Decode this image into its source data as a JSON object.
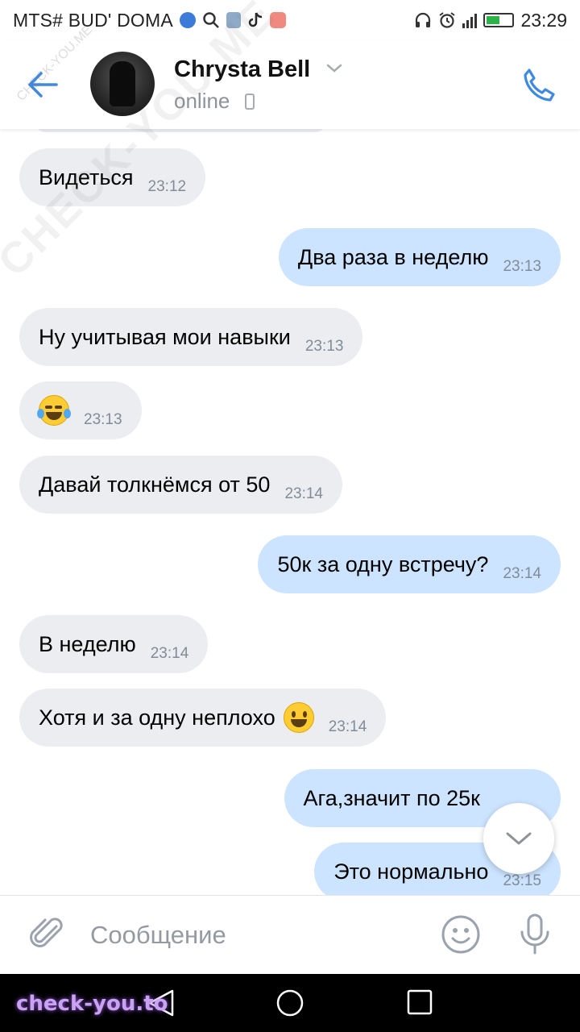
{
  "status_bar": {
    "carrier": "MTS# BUD' DOMA",
    "time": "23:29"
  },
  "header": {
    "contact_name": "Chrysta Bell",
    "status": "online"
  },
  "messages": [
    {
      "direction": "in",
      "text": "Видеться",
      "time": "23:12"
    },
    {
      "direction": "out",
      "text": "Два раза в неделю",
      "time": "23:13"
    },
    {
      "direction": "in",
      "text": "Ну учитывая мои навыки",
      "time": "23:13"
    },
    {
      "direction": "in",
      "text": "",
      "emoji": "tears-of-joy-emoji",
      "time": "23:13"
    },
    {
      "direction": "in",
      "text": "Давай толкнёмся от 50",
      "time": "23:14"
    },
    {
      "direction": "out",
      "text": "50к за одну встречу?",
      "time": "23:14"
    },
    {
      "direction": "in",
      "text": "В неделю",
      "time": "23:14"
    },
    {
      "direction": "in",
      "text": "Хотя и за одну неплохо",
      "emoji": "smiley-emoji",
      "time": "23:14"
    },
    {
      "direction": "out",
      "text": "Ага,значит по 25к",
      "time": ""
    },
    {
      "direction": "out",
      "text": "Это нормально",
      "time": "23:15"
    }
  ],
  "composer": {
    "placeholder": "Сообщение"
  },
  "watermarks": {
    "diagonal": "CHECK-YOU.ME",
    "small": "CHECK-YOU.ME",
    "bottom": "check-you.to"
  },
  "colors": {
    "accent": "#3f8ae0",
    "incoming_bubble": "#ebedf0",
    "outgoing_bubble": "#cce4ff",
    "time_text": "#818c99"
  }
}
